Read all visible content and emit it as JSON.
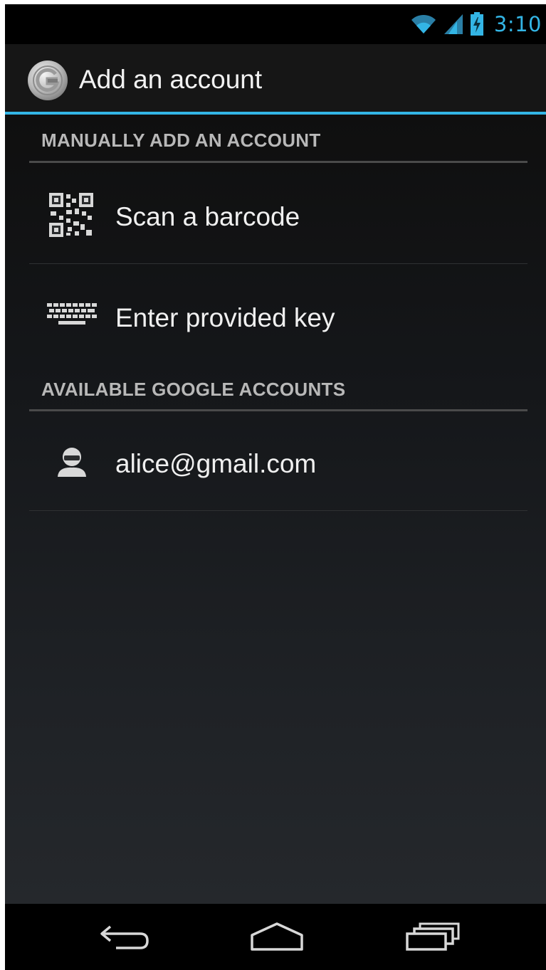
{
  "status_bar": {
    "time": "3:10",
    "icons": [
      "wifi-icon",
      "cell-signal-icon",
      "battery-charging-icon"
    ],
    "accent_color": "#33b5e5"
  },
  "action_bar": {
    "title": "Add an account",
    "icon": "authenticator-app-icon"
  },
  "sections": [
    {
      "header": "MANUALLY ADD AN ACCOUNT",
      "items": [
        {
          "label": "Scan a barcode",
          "icon": "qr-code-icon"
        },
        {
          "label": "Enter provided key",
          "icon": "keyboard-icon"
        }
      ]
    },
    {
      "header": "AVAILABLE GOOGLE ACCOUNTS",
      "items": [
        {
          "label": "alice@gmail.com",
          "icon": "account-icon"
        }
      ]
    }
  ],
  "nav_bar": {
    "buttons": [
      "back-icon",
      "home-icon",
      "recent-apps-icon"
    ]
  }
}
